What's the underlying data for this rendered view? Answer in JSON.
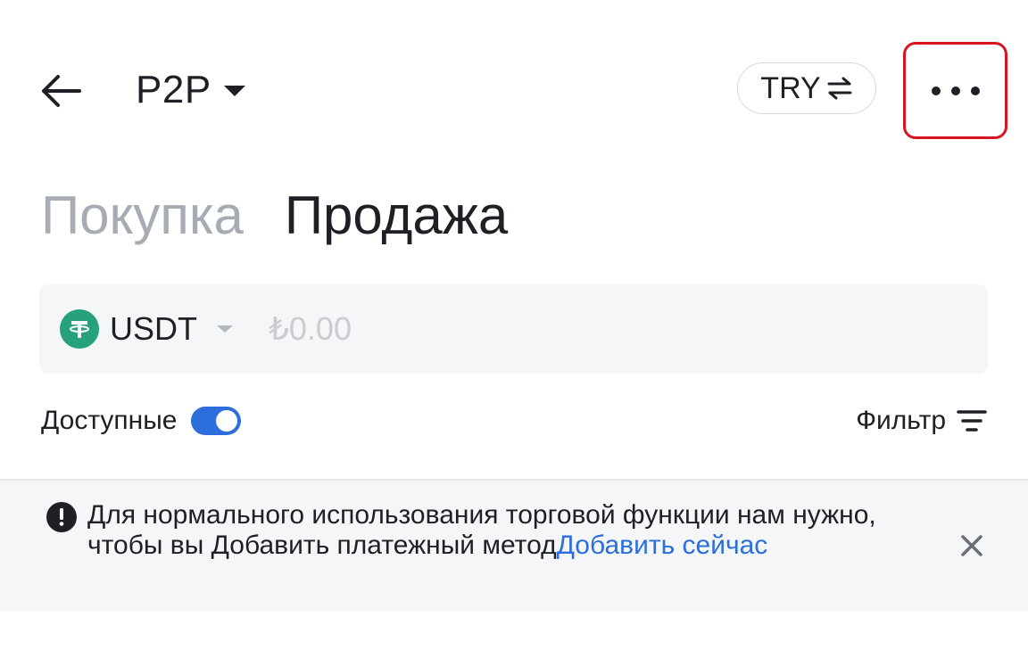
{
  "header": {
    "title": "P2P",
    "currency": "TRY",
    "back_icon": "arrow-left-icon",
    "more_icon": "more-horizontal-icon"
  },
  "tabs": [
    {
      "label": "Покупка",
      "active": false
    },
    {
      "label": "Продажа",
      "active": true
    }
  ],
  "asset": {
    "symbol": "USDT",
    "amount_placeholder": "₺0.00",
    "amount_value": ""
  },
  "filters": {
    "available_label": "Доступные",
    "available_enabled": true,
    "filter_label": "Фильтр"
  },
  "notice": {
    "text": "Для нормального использования торговой функции нам нужно, чтобы вы Добавить платежный метод",
    "link_label": "Добавить сейчас"
  },
  "colors": {
    "accent_blue": "#2c6fdc",
    "tether_green": "#26a17b",
    "highlight_red": "#d8161f",
    "muted_text": "#a7abb3"
  }
}
